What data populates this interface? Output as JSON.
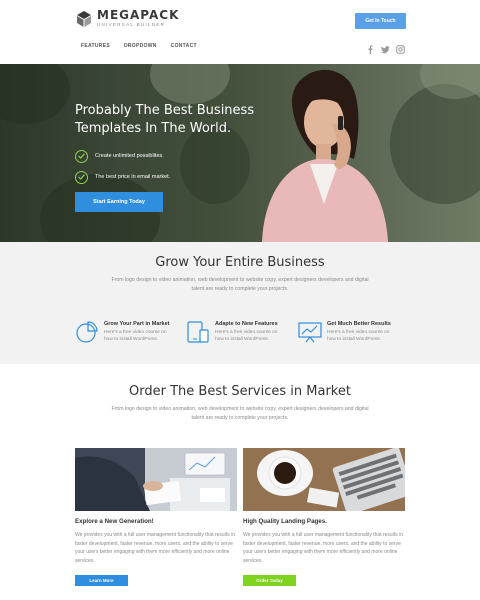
{
  "header": {
    "logo_name": "MEGAPACK",
    "logo_tagline": "UNIVERSAL BUILDER",
    "cta_label": "Get In Touch",
    "nav": [
      "FEATURES",
      "DROPDOWN",
      "CONTACT"
    ],
    "social_icons": [
      "facebook-icon",
      "twitter-icon",
      "instagram-icon"
    ]
  },
  "hero": {
    "title": "Probably The Best Business Templates In The World.",
    "items": [
      "Create unlimited possiblites.",
      "The best price in email market."
    ],
    "button_label": "Start Earning Today"
  },
  "grow": {
    "title": "Grow Your Entire Business",
    "subtitle": "From logo design to video animation, web development to website copy, expert designers developers and digital talent are ready to complete your projects.",
    "features": [
      {
        "icon": "pie-chart-icon",
        "title": "Grow Your Part in Market",
        "desc": "Here's a free video course on how to install WordPress."
      },
      {
        "icon": "devices-icon",
        "title": "Adapte to New Features",
        "desc": "Here's a free video course on how to install WordPress."
      },
      {
        "icon": "presentation-chart-icon",
        "title": "Get Much Better Results",
        "desc": "Here's a free video course on how to install WordPress."
      }
    ]
  },
  "services": {
    "title": "Order The Best Services in Market",
    "subtitle": "From logo design to video animation, web development to website copy, expert designers developers and digital talent are ready to complete your projects.",
    "cards": [
      {
        "title": "Explore a New Generation!",
        "desc": "We provides you with a full user management functionality that results in faster development, faster revenue, more users, and the ability to serve your users better engaging with them more efficiently and more online services.",
        "button_label": "Learn More",
        "button_color": "#2f8fde"
      },
      {
        "title": "High Quality Landing Pages.",
        "desc": "We provides you with a full user management functionality that results in faster development, faster revenue, more users, and the ability to serve your users better engaging with them more efficiently and more online services.",
        "button_label": "Order Today",
        "button_color": "#7ed321"
      }
    ]
  },
  "colors": {
    "accent_blue": "#2f8fde",
    "accent_green": "#7ed321",
    "check_green": "#8fd14f"
  }
}
